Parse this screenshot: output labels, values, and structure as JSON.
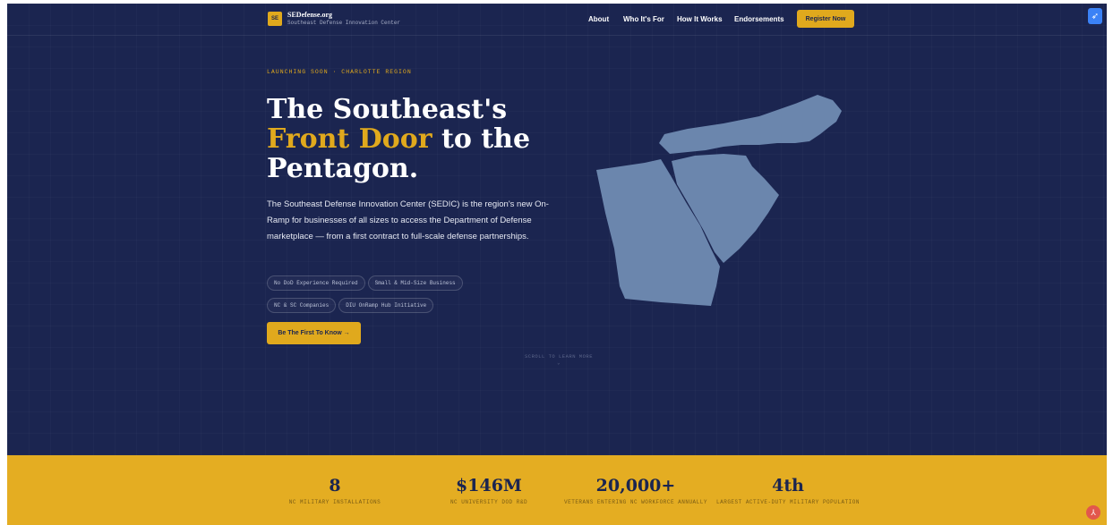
{
  "brand": {
    "logo_text": "SE",
    "name": "SEDefense.org",
    "subtitle": "Southeast Defense Innovation Center"
  },
  "nav": {
    "links": [
      "About",
      "Who It's For",
      "How It Works",
      "Endorsements"
    ],
    "cta": "Register Now"
  },
  "hero": {
    "eyebrow": "LAUNCHING SOON · CHARLOTTE REGION",
    "headline_line1": "The Southeast's",
    "headline_gold": "Front Door",
    "headline_line2_rest": " to the",
    "headline_line3": "Pentagon.",
    "lede": "The Southeast Defense Innovation Center (SEDIC) is the region's new On-Ramp for businesses of all sizes to access the Department of Defense marketplace — from a first contract to full-scale defense partnerships.",
    "tags": [
      "No DoD Experience Required",
      "Small & Mid-Size Business",
      "NC & SC Companies",
      "DIU OnRamp Hub Initiative"
    ],
    "cta": "Be The First To Know →",
    "scroll_hint": "SCROLL TO LEARN MORE"
  },
  "stats": [
    {
      "value": "8",
      "label": "NC MILITARY INSTALLATIONS"
    },
    {
      "value": "$146M",
      "label": "NC UNIVERSITY DOD R&D"
    },
    {
      "value": "20,000+",
      "label": "VETERANS ENTERING NC WORKFORCE ANNUALLY"
    },
    {
      "value": "4th",
      "label": "LARGEST ACTIVE-DUTY MILITARY POPULATION"
    }
  ],
  "icons": {
    "corner": "rocket-icon",
    "bottom_right": "pdf-icon",
    "map": "southeast-map-icon"
  },
  "colors": {
    "navy": "#1b2550",
    "gold": "#e0a91d",
    "map": "#6b86ad"
  }
}
